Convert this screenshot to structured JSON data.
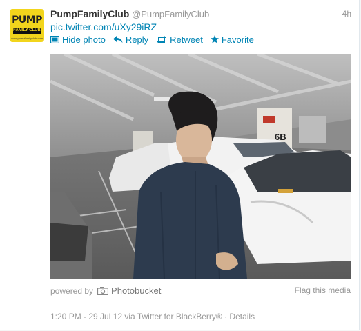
{
  "tweet": {
    "display_name": "PumpFamilyClub",
    "handle": "@PumpFamilyClub",
    "time_ago": "4h",
    "link_text": "pic.twitter.com/uXy29iRZ",
    "avatar": {
      "logo_text": "PUMP",
      "logo_sub": "FAMILY CLUB",
      "logo_url": "www.pumpfamilyclub.com"
    },
    "actions": [
      {
        "label": "Hide photo",
        "icon": "photo-icon"
      },
      {
        "label": "Reply",
        "icon": "reply-icon"
      },
      {
        "label": "Retweet",
        "icon": "retweet-icon"
      },
      {
        "label": "Favorite",
        "icon": "star-icon"
      }
    ],
    "media": {
      "powered_by": "powered by",
      "provider": "Photobucket",
      "provider_icon": "camera-icon",
      "flag_label": "Flag this media",
      "sign_text": "6B"
    },
    "footer": {
      "timestamp": "1:20 PM - 29 Jul 12 via Twitter for BlackBerry®",
      "separator": "·",
      "details": "Details"
    }
  },
  "colors": {
    "link": "#0084b4",
    "muted": "#999999",
    "avatar_bg": "#f2d51c"
  }
}
